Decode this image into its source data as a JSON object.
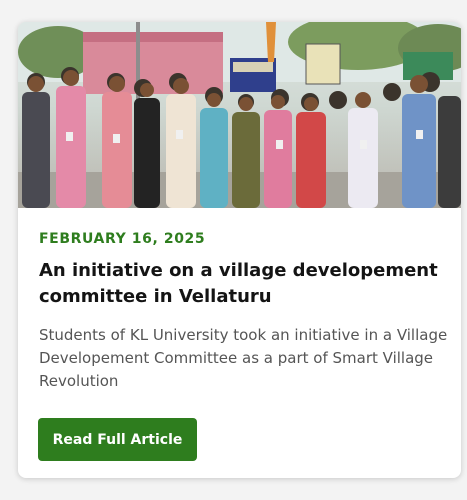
{
  "article": {
    "image_alt": "Students of KL University with village committee members",
    "date": "FEBRUARY 16, 2025",
    "title": "An initiative on a village developement committee in Vellaturu",
    "excerpt": "Students of KL University took an initiative in a Village Developement Committee as a part of Smart Village Revolution",
    "cta_label": "Read Full Article"
  },
  "colors": {
    "accent": "#2e7d1e",
    "title": "#141414",
    "body_text": "#555555",
    "card_bg": "#ffffff",
    "page_bg": "#f3f3f3"
  }
}
